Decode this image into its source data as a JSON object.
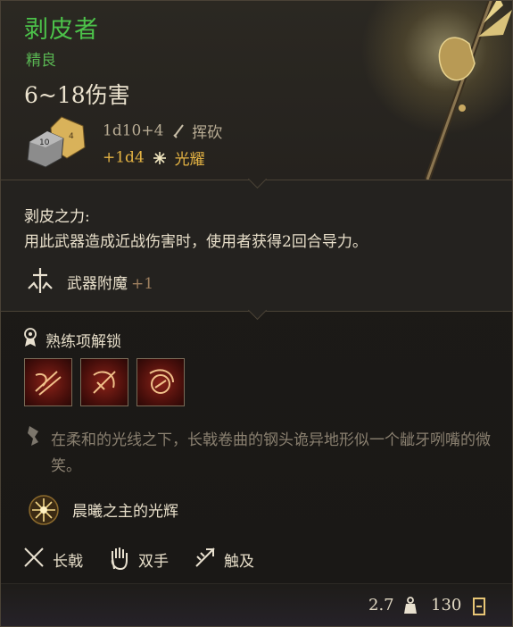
{
  "item": {
    "name": "剥皮者",
    "rarity": "精良",
    "damage_range": "6~18伤害",
    "primary_roll": "1d10+4",
    "primary_type": "挥砍",
    "bonus_roll": "+1d4",
    "bonus_type": "光耀",
    "name_color": "#4cc24a"
  },
  "perk": {
    "title": "剥皮之力:",
    "description": "用此武器造成近战伤害时，使用者获得2回合导力。"
  },
  "enchantment": {
    "label": "武器附魔",
    "value": "+1"
  },
  "proficiency": {
    "label": "熟练项解锁",
    "skills": [
      "skill-1",
      "skill-2",
      "skill-3"
    ]
  },
  "flavor": {
    "text": "在柔和的光线之下，长戟卷曲的钢头诡异地形似一个龇牙咧嘴的微笑。"
  },
  "passive": {
    "label": "晨曦之主的光辉"
  },
  "properties": [
    {
      "label": "长戟",
      "icon": "crossed-polearms-icon"
    },
    {
      "label": "双手",
      "icon": "hand-icon"
    },
    {
      "label": "触及",
      "icon": "reach-icon"
    }
  ],
  "footer": {
    "weight": "2.7",
    "price": "130"
  }
}
